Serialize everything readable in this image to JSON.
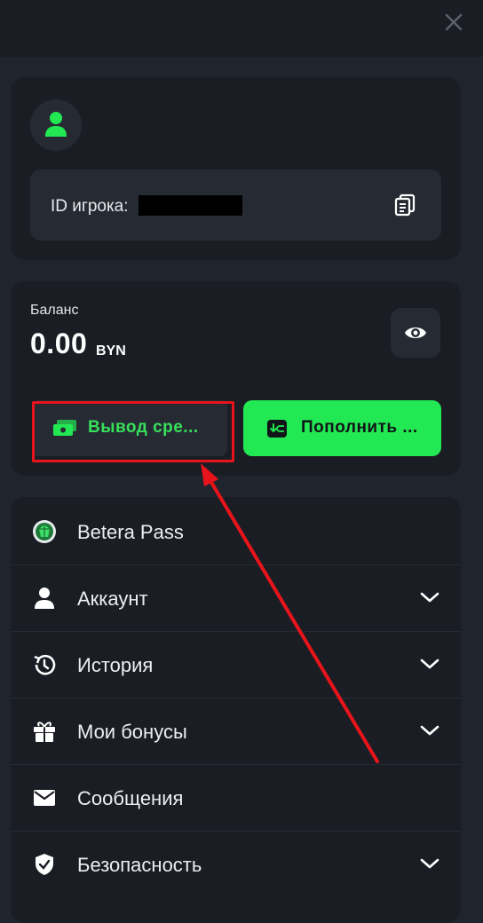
{
  "profile": {
    "id_label": "ID игрока:"
  },
  "balance": {
    "label": "Баланс",
    "amount": "0.00",
    "currency": "BYN"
  },
  "actions": {
    "withdraw_label": "Вывод сре...",
    "deposit_label": "Пополнить ..."
  },
  "menu": {
    "items": [
      {
        "label": "Betera Pass",
        "icon": "betera-pass-icon",
        "expandable": false
      },
      {
        "label": "Аккаунт",
        "icon": "user-icon",
        "expandable": true
      },
      {
        "label": "История",
        "icon": "history-icon",
        "expandable": true
      },
      {
        "label": "Мои бонусы",
        "icon": "gift-icon",
        "expandable": true
      },
      {
        "label": "Сообщения",
        "icon": "mail-icon",
        "expandable": false
      },
      {
        "label": "Безопасность",
        "icon": "shield-icon",
        "expandable": true
      }
    ]
  },
  "colors": {
    "accent": "#22e853",
    "background": "#20242c",
    "card": "#1a1d23",
    "annotation": "#e8141b"
  }
}
